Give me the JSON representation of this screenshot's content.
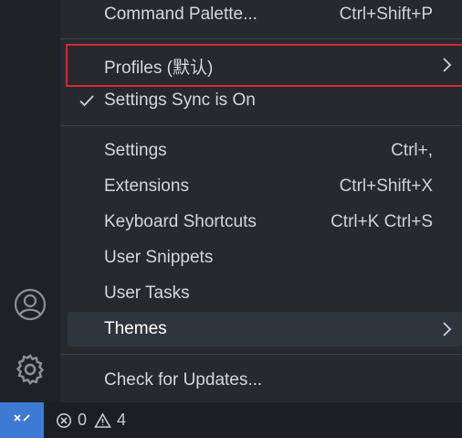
{
  "menu": {
    "items": [
      {
        "label": "Command Palette...",
        "shortcut": "Ctrl+Shift+P"
      },
      {
        "label": "Profiles (默认)",
        "shortcut": ""
      },
      {
        "label": "Settings Sync is On",
        "shortcut": ""
      },
      {
        "label": "Settings",
        "shortcut": "Ctrl+,"
      },
      {
        "label": "Extensions",
        "shortcut": "Ctrl+Shift+X"
      },
      {
        "label": "Keyboard Shortcuts",
        "shortcut": "Ctrl+K Ctrl+S"
      },
      {
        "label": "User Snippets",
        "shortcut": ""
      },
      {
        "label": "User Tasks",
        "shortcut": ""
      },
      {
        "label": "Themes",
        "shortcut": ""
      },
      {
        "label": "Check for Updates...",
        "shortcut": ""
      }
    ]
  },
  "status": {
    "errors": "0",
    "warnings": "4"
  },
  "colors": {
    "accent": "#3e7ad4",
    "highlight_border": "#d9272e",
    "menu_bg": "#252a2f"
  },
  "icons": [
    "account-icon",
    "settings-gear-icon",
    "remote-icon",
    "error-icon",
    "warning-icon",
    "checkmark-icon",
    "chevron-right-icon"
  ]
}
